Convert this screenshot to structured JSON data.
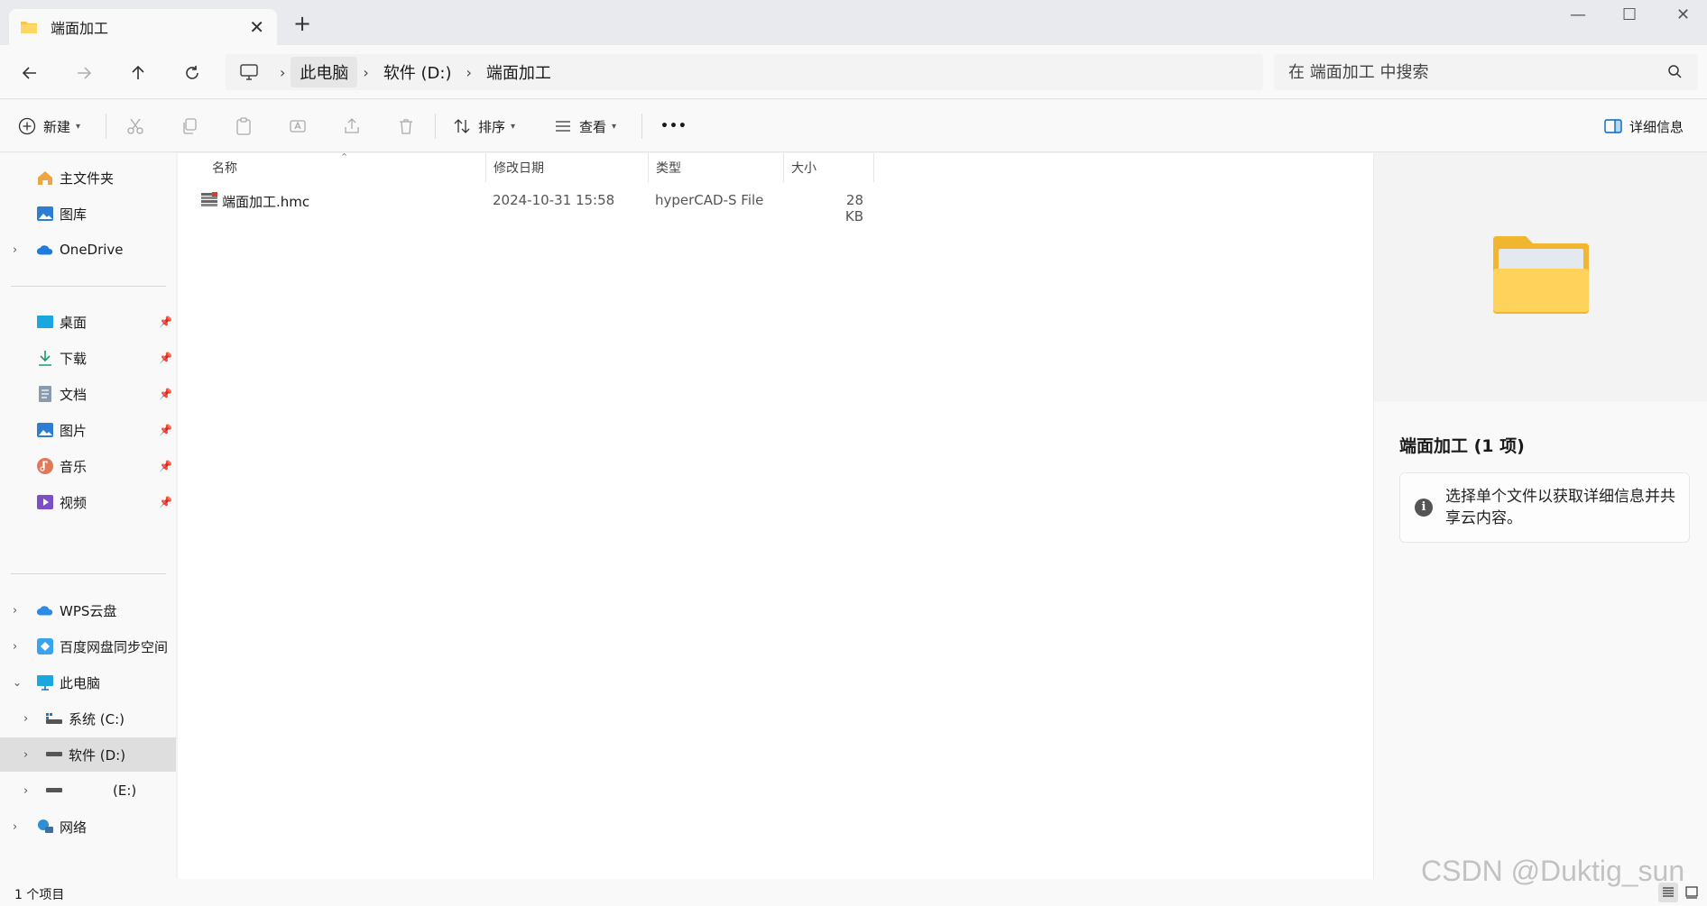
{
  "tab": {
    "title": "端面加工",
    "close": "✕",
    "new_tab": "+"
  },
  "window_controls": {
    "minimize": "—",
    "maximize": "☐",
    "close": "✕"
  },
  "breadcrumb": [
    "此电脑",
    "软件 (D:)",
    "端面加工"
  ],
  "search": {
    "placeholder": "在 端面加工 中搜索"
  },
  "toolbar": {
    "new_label": "新建",
    "sort_label": "排序",
    "view_label": "查看",
    "more": "•••",
    "details_label": "详细信息"
  },
  "sidebar": {
    "top": [
      {
        "label": "主文件夹",
        "icon": "home-icon"
      },
      {
        "label": "图库",
        "icon": "gallery-icon"
      },
      {
        "label": "OneDrive",
        "icon": "onedrive-icon"
      }
    ],
    "pinned": [
      {
        "label": "桌面",
        "icon": "desktop-icon"
      },
      {
        "label": "下载",
        "icon": "download-icon"
      },
      {
        "label": "文档",
        "icon": "document-icon"
      },
      {
        "label": "图片",
        "icon": "pictures-icon"
      },
      {
        "label": "音乐",
        "icon": "music-icon"
      },
      {
        "label": "视频",
        "icon": "video-icon"
      }
    ],
    "bottom": [
      {
        "label": "WPS云盘",
        "icon": "wps-cloud-icon"
      },
      {
        "label": "百度网盘同步空间",
        "icon": "baidu-netdisk-icon"
      },
      {
        "label": "此电脑",
        "icon": "this-pc-icon"
      },
      {
        "label": "系统 (C:)",
        "icon": "drive-c-icon"
      },
      {
        "label": "软件 (D:)",
        "icon": "drive-d-icon"
      },
      {
        "label": "(E:)",
        "icon": "drive-e-icon"
      },
      {
        "label": "网络",
        "icon": "network-icon"
      }
    ]
  },
  "columns": {
    "name": "名称",
    "modified": "修改日期",
    "type": "类型",
    "size": "大小"
  },
  "files": [
    {
      "name": "端面加工.hmc",
      "modified": "2024-10-31 15:58",
      "type": "hyperCAD-S File",
      "size": "28 KB"
    }
  ],
  "details": {
    "title": "端面加工 (1 项)",
    "info": "选择单个文件以获取详细信息并共享云内容。"
  },
  "status": {
    "count": "1 个项目"
  },
  "watermark": "CSDN @Duktig_sun",
  "colors": {
    "folder": "#f8c644",
    "accent": "#0067c0",
    "selected": "#dedede"
  }
}
